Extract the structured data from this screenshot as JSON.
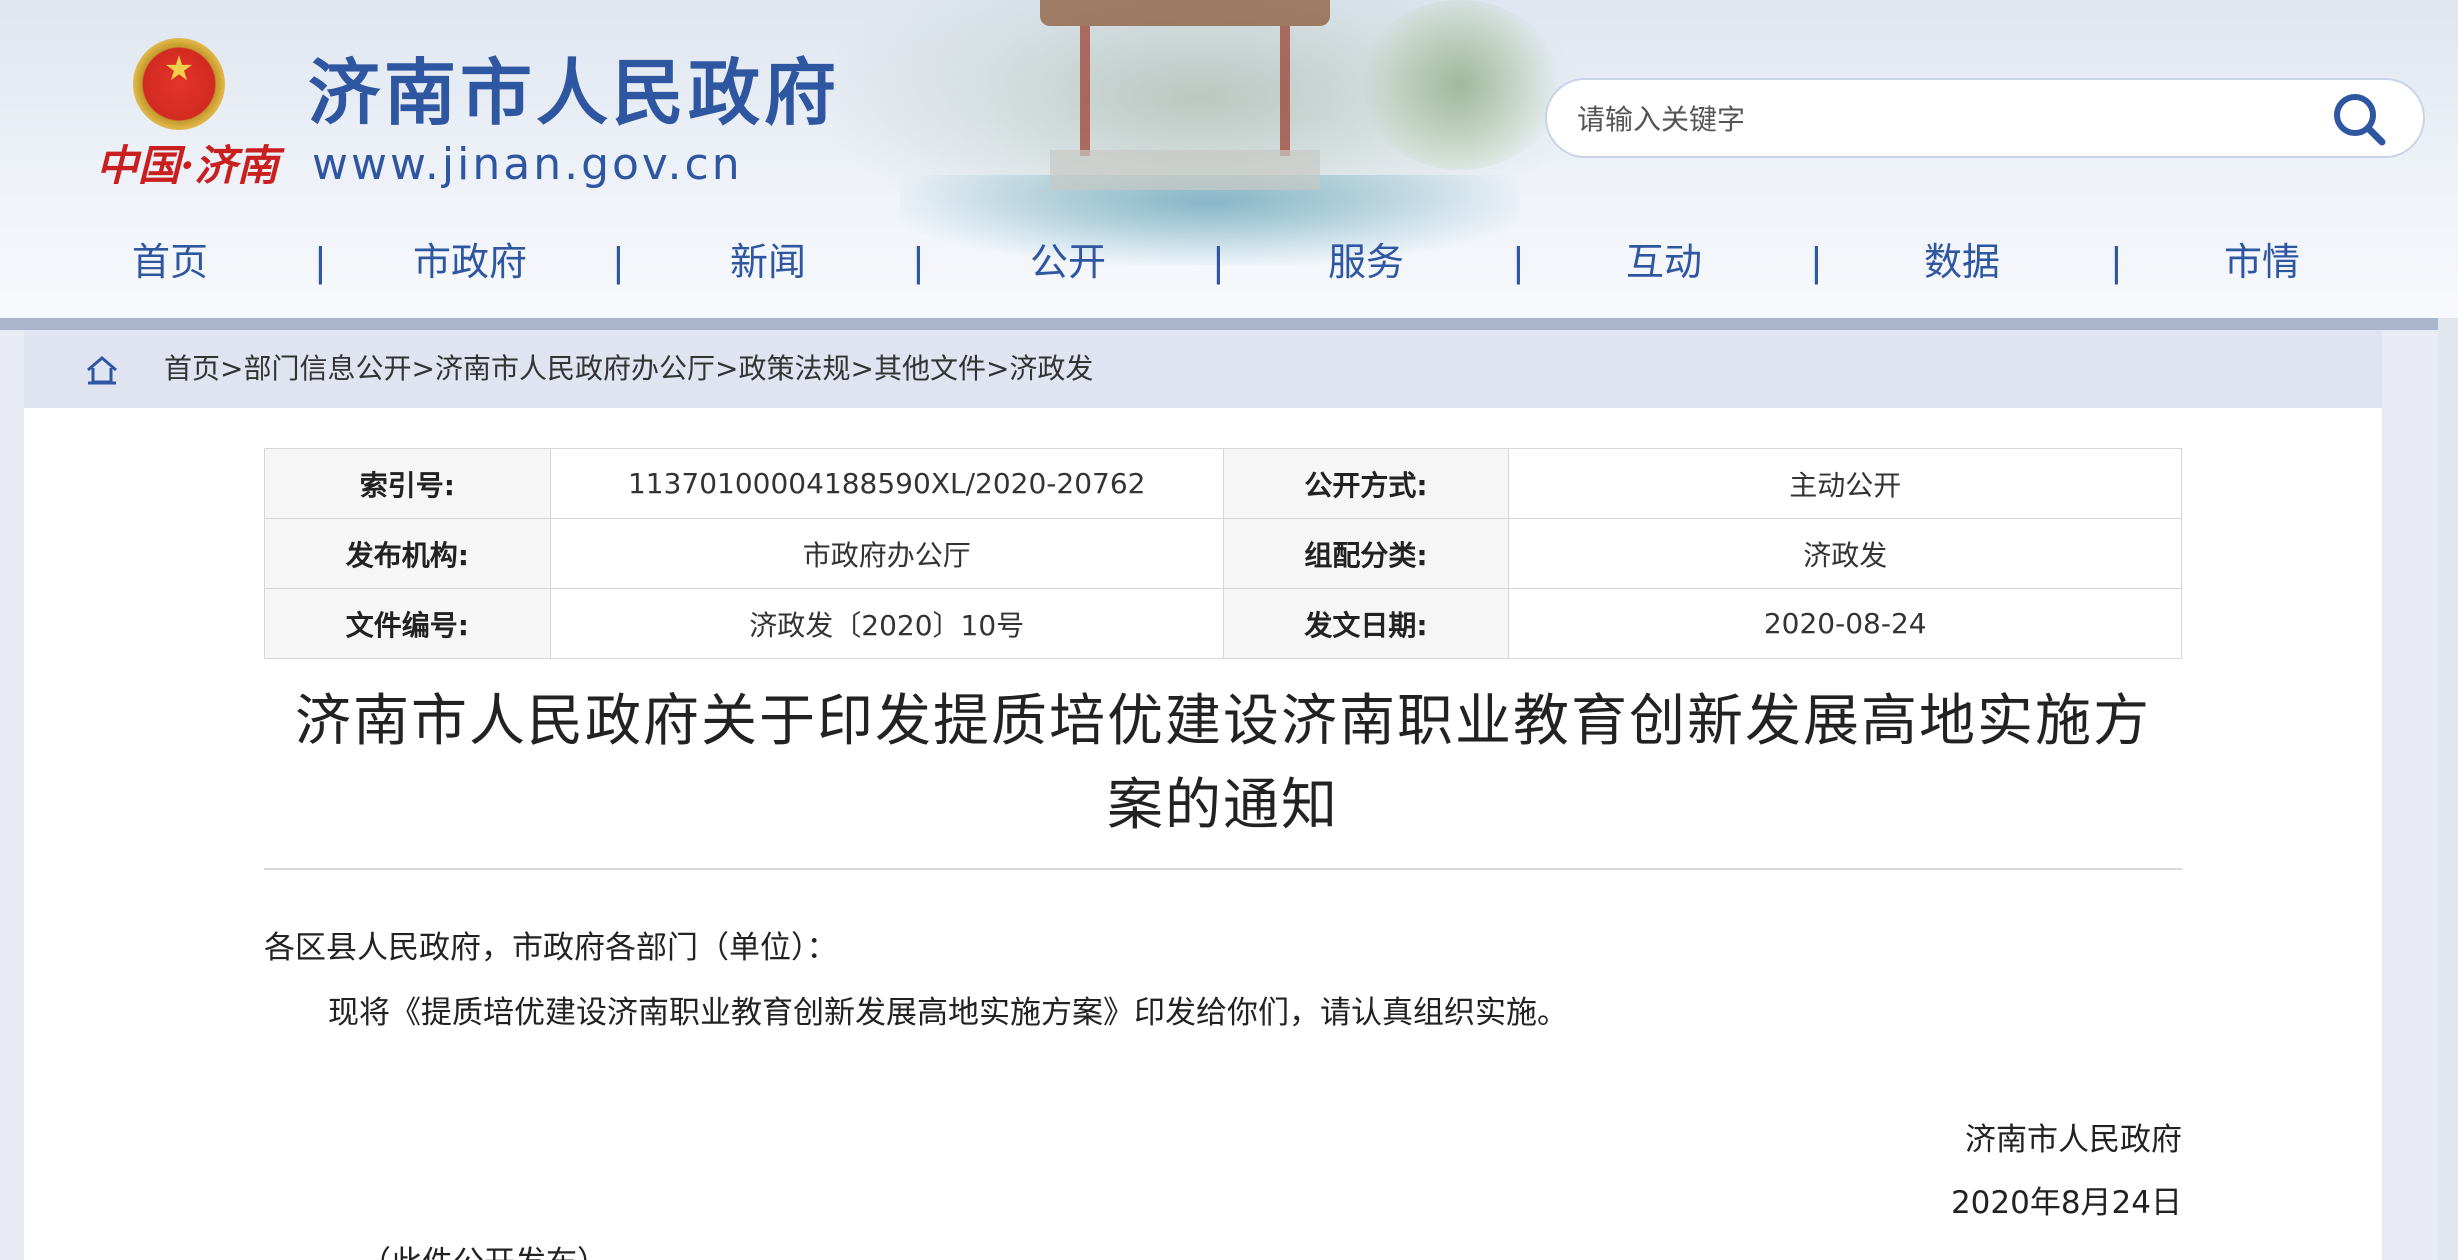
{
  "header": {
    "site_title": "济南市人民政府",
    "site_url": "www.jinan.gov.cn",
    "city_mark": "中国·济南",
    "search_placeholder": "请输入关键字"
  },
  "nav": {
    "items": [
      "首页",
      "市政府",
      "新闻",
      "公开",
      "服务",
      "互动",
      "数据",
      "市情"
    ],
    "separator": "|"
  },
  "breadcrumb": {
    "items": [
      "首页",
      "部门信息公开",
      "济南市人民政府办公厅",
      "政策法规",
      "其他文件",
      "济政发"
    ],
    "separator": ">"
  },
  "meta": {
    "index_label": "索引号:",
    "index_value": "11370100004188590XL/2020-20762",
    "method_label": "公开方式:",
    "method_value": "主动公开",
    "publisher_label": "发布机构:",
    "publisher_value": "市政府办公厅",
    "category_label": "组配分类:",
    "category_value": "济政发",
    "docno_label": "文件编号:",
    "docno_value": "济政发〔2020〕10号",
    "date_label": "发文日期:",
    "date_value": "2020-08-24"
  },
  "document": {
    "title_line1": "济南市人民政府关于印发提质培优建设济南职业教育创新发展高地实施方",
    "title_line2": "案的通知",
    "salutation": "各区县人民政府，市政府各部门（单位）：",
    "body": "现将《提质培优建设济南职业教育创新发展高地实施方案》印发给你们，请认真组织实施。",
    "sign_org": "济南市人民政府",
    "sign_date": "2020年8月24日",
    "footnote": "（此件公开发布）"
  }
}
